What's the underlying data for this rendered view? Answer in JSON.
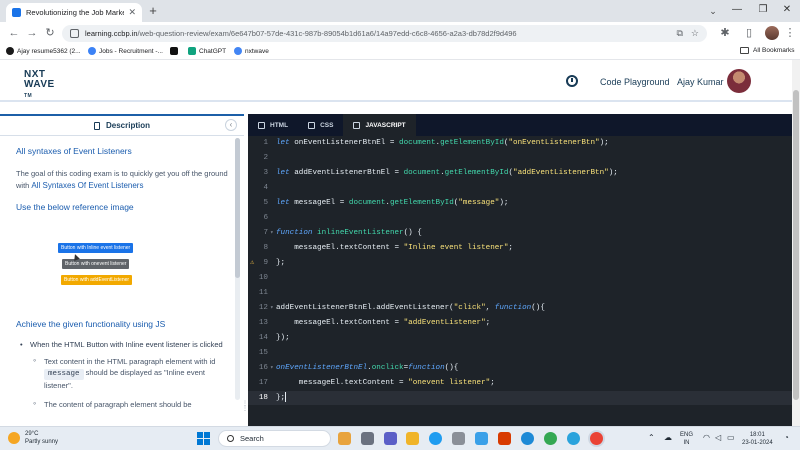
{
  "browser": {
    "tab_title": "Revolutionizing the Job Market",
    "url_host": "learning.ccbp.in",
    "url_path": "/web-question-review/exam/6e647b07-57de-431c-987b-89054b1d61a6/14a97edd-c6c8-4656-a2a3-db78d2f9d496",
    "bookmarks": [
      "Ajay resume5362 (2...",
      "Jobs - Recruitment -...",
      "ChatGPT",
      "nxtwave"
    ],
    "all_bookmarks": "All Bookmarks"
  },
  "header": {
    "logo_line1": "NXT",
    "logo_line2": "WAVE",
    "logo_suffix": "TM",
    "code_playground": "Code Playground",
    "user_name": "Ajay Kumar"
  },
  "description": {
    "tab_label": "Description",
    "title": "All syntaxes of Event Listeners",
    "intro": "The goal of this coding exam is to quickly get you off the ground with ",
    "intro_highlight": "All Syntaxes Of Event Listeners",
    "reference_heading": "Use the below reference image",
    "ref_buttons": [
      {
        "label": "Button with Inline event listener",
        "color": "#1a73e8"
      },
      {
        "label": "Button with onevent listener",
        "color": "#5f6368"
      },
      {
        "label": "Button with addEventListener",
        "color": "#f2a900"
      }
    ],
    "functionality_heading": "Achieve the given functionality using JS",
    "bullet1": "When the HTML Button with Inline event listener is clicked",
    "sub1_prefix": "Text content in the HTML paragraph element with id",
    "sub1_code": "message",
    "sub1_suffix": "should be displayed as \"Inline event listener\".",
    "sub2": "The content of paragraph element should be"
  },
  "editor": {
    "tabs": [
      {
        "label": "HTML",
        "active": false
      },
      {
        "label": "CSS",
        "active": false
      },
      {
        "label": "JAVASCRIPT",
        "active": true
      }
    ],
    "line_count": 18,
    "active_line": 18,
    "warning_line": 9
  },
  "taskbar": {
    "temperature": "29°C",
    "weather": "Partly sunny",
    "search": "Search",
    "lang1": "ENG",
    "lang2": "IN",
    "time": "18:01",
    "date": "23-01-2024"
  }
}
